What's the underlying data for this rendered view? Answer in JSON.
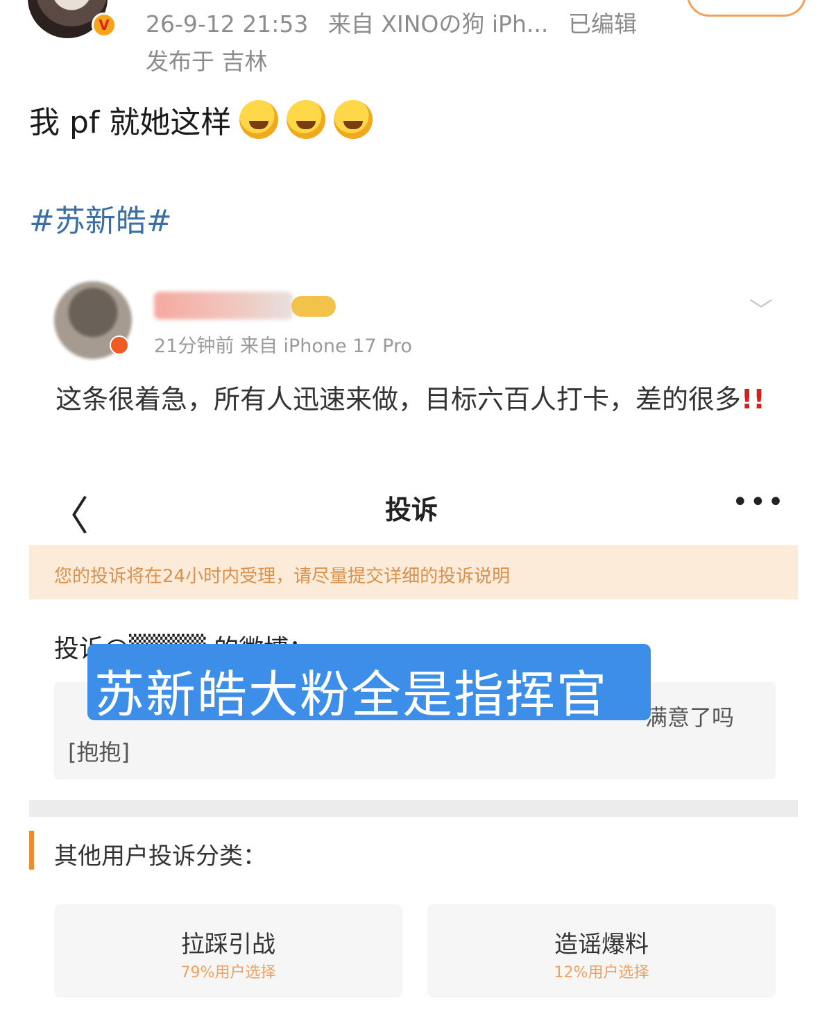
{
  "post": {
    "timestamp": "26-9-12 21:53",
    "source": "来自 XINOの狗 iPh...",
    "edited": "已编辑",
    "location": "发布于 吉林",
    "verified_badge": "V",
    "text": "我 pf 就她这样",
    "emoji_icons": [
      "rofl-emoji",
      "rofl-emoji",
      "rofl-emoji"
    ],
    "hashtag": "#苏新皓#"
  },
  "embedded": {
    "meta": "21分钟前  来自 iPhone 17 Pro",
    "body": "这条很着急，所有人迅速来做，目标六百人打卡，差的很多",
    "body_mark": "!!",
    "nav": {
      "back": "〈",
      "title": "投诉",
      "more": "•••"
    },
    "notice": "您的投诉将在24小时内受理，请尽量提交详细的投诉说明",
    "complain_label": "投诉@▒▒▒▒ 的微博：",
    "quote_line1": "满意了吗",
    "quote_line2": "[抱抱]",
    "section_title": "其他用户投诉分类：",
    "categories": [
      {
        "name": "拉踩引战",
        "pct": "79%用户选择"
      },
      {
        "name": "造谣爆料",
        "pct": "12%用户选择"
      }
    ]
  },
  "overlay": {
    "caption": "苏新皓大粉全是指挥官"
  },
  "colors": {
    "hashtag": "#3a6ea5",
    "overlay_bg": "#3c8ee8",
    "notice_bg": "#fcebd9",
    "notice_text": "#d9914f",
    "accent": "#f08a2c"
  }
}
